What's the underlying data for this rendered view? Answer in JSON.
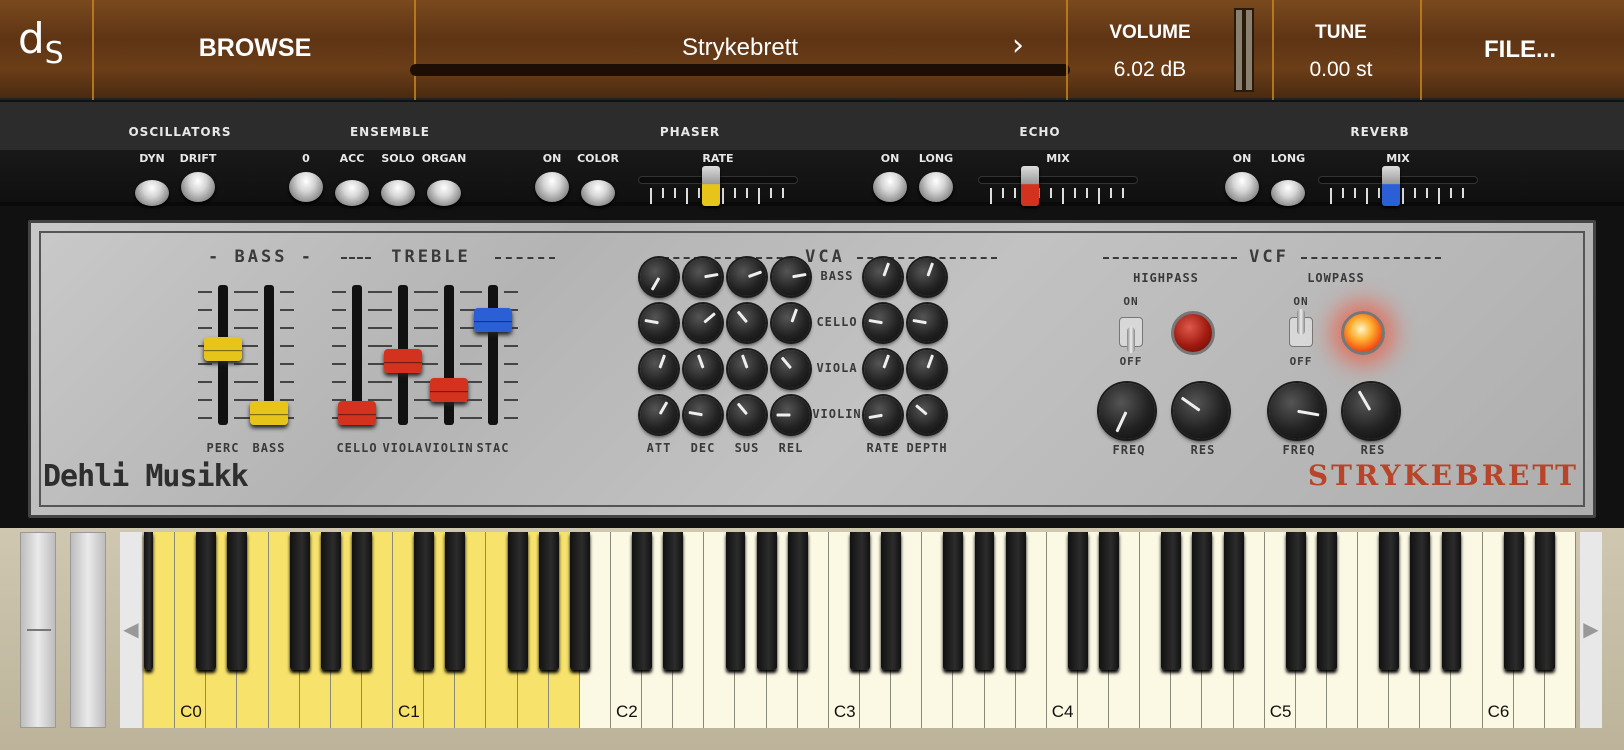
{
  "topbar": {
    "logo_main": "d",
    "logo_sub": "S",
    "browse_label": "BROWSE",
    "preset_name": "Strykebrett",
    "next_glyph": "›",
    "volume_label": "VOLUME",
    "volume_value": "6.02 dB",
    "tune_label": "TUNE",
    "tune_value": "0.00 st",
    "file_label": "FILE..."
  },
  "effects": {
    "oscillators": {
      "title": "OSCILLATORS",
      "buttons": [
        "DYN",
        "DRIFT"
      ],
      "pressed": [
        true,
        false
      ]
    },
    "ensemble": {
      "title": "ENSEMBLE",
      "buttons": [
        "0",
        "ACC",
        "SOLO",
        "ORGAN"
      ],
      "pressed": [
        false,
        true,
        true,
        true
      ]
    },
    "phaser": {
      "title": "PHASER",
      "buttons": [
        "ON",
        "COLOR"
      ],
      "pressed": [
        false,
        true
      ],
      "slider_label": "RATE",
      "slider_value": 0.45,
      "slider_color": "#e6c419"
    },
    "echo": {
      "title": "ECHO",
      "buttons": [
        "ON",
        "LONG"
      ],
      "pressed": [
        false,
        false
      ],
      "slider_label": "MIX",
      "slider_value": 0.3,
      "slider_color": "#d3321e"
    },
    "reverb": {
      "title": "REVERB",
      "buttons": [
        "ON",
        "LONG"
      ],
      "pressed": [
        false,
        true
      ],
      "slider_label": "MIX",
      "slider_value": 0.45,
      "slider_color": "#2a5fd6"
    }
  },
  "panel": {
    "bass": {
      "title": "BASS",
      "faders": [
        {
          "label": "PERC",
          "value": 0.55,
          "color": "#e6c419"
        },
        {
          "label": "BASS",
          "value": 0.0,
          "color": "#e6c419"
        }
      ]
    },
    "treble": {
      "title": "TREBLE",
      "faders": [
        {
          "label": "CELLO",
          "value": 0.0,
          "color": "#d3321e"
        },
        {
          "label": "VIOLA",
          "value": 0.45,
          "color": "#d3321e"
        },
        {
          "label": "VIOLIN",
          "value": 0.2,
          "color": "#d3321e"
        },
        {
          "label": "STAC",
          "value": 0.8,
          "color": "#2a5fd6"
        }
      ]
    },
    "vca": {
      "title": "VCA",
      "rows": [
        "BASS",
        "CELLO",
        "VIOLA",
        "VIOLIN"
      ],
      "columns": [
        "ATT",
        "DEC",
        "SUS",
        "REL"
      ],
      "mod_columns": [
        "RATE",
        "DEPTH"
      ],
      "knob_angles": [
        [
          -150,
          80,
          70,
          80,
          20,
          20
        ],
        [
          -80,
          50,
          -40,
          20,
          -80,
          -80
        ],
        [
          20,
          -20,
          -20,
          -40,
          20,
          20
        ],
        [
          30,
          -80,
          -40,
          -90,
          -100,
          -50
        ]
      ]
    },
    "vcf": {
      "title": "VCF",
      "highpass": {
        "title": "HIGHPASS",
        "on_label": "ON",
        "off_label": "OFF",
        "on": false,
        "freq_label": "FREQ",
        "res_label": "RES",
        "freq_angle": -155,
        "res_angle": -55
      },
      "lowpass": {
        "title": "LOWPASS",
        "on_label": "ON",
        "off_label": "OFF",
        "on": true,
        "freq_label": "FREQ",
        "res_label": "RES",
        "freq_angle": 100,
        "res_angle": -30
      }
    },
    "brand": "Dehli Musikk",
    "product": "STRYKEBRETT"
  },
  "keyboard": {
    "octave_labels": [
      "C0",
      "C1",
      "C2",
      "C3",
      "C4",
      "C5",
      "C6"
    ],
    "white_key_count": 46,
    "highlight_white_keys": 14,
    "highlight_color": "#f7e26b",
    "white_color": "#fbf8e4",
    "left_arrow": "◀",
    "right_arrow": "▶"
  }
}
